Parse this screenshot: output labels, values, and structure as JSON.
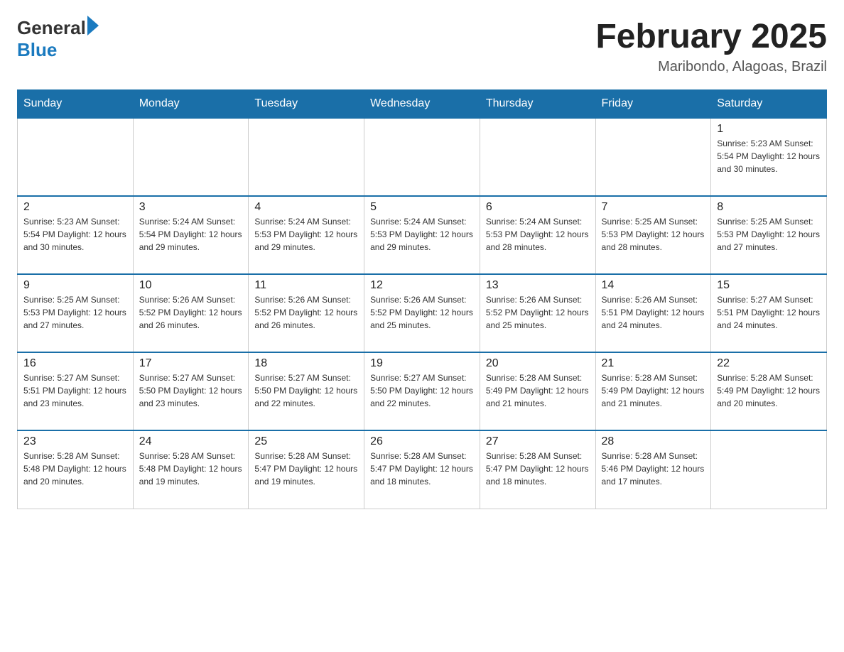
{
  "header": {
    "logo": {
      "general": "General",
      "blue": "Blue"
    },
    "title": "February 2025",
    "subtitle": "Maribondo, Alagoas, Brazil"
  },
  "days_of_week": [
    "Sunday",
    "Monday",
    "Tuesday",
    "Wednesday",
    "Thursday",
    "Friday",
    "Saturday"
  ],
  "weeks": [
    [
      {
        "day": "",
        "info": "",
        "empty": true
      },
      {
        "day": "",
        "info": "",
        "empty": true
      },
      {
        "day": "",
        "info": "",
        "empty": true
      },
      {
        "day": "",
        "info": "",
        "empty": true
      },
      {
        "day": "",
        "info": "",
        "empty": true
      },
      {
        "day": "",
        "info": "",
        "empty": true
      },
      {
        "day": "1",
        "info": "Sunrise: 5:23 AM\nSunset: 5:54 PM\nDaylight: 12 hours and 30 minutes.",
        "empty": false
      }
    ],
    [
      {
        "day": "2",
        "info": "Sunrise: 5:23 AM\nSunset: 5:54 PM\nDaylight: 12 hours and 30 minutes.",
        "empty": false
      },
      {
        "day": "3",
        "info": "Sunrise: 5:24 AM\nSunset: 5:54 PM\nDaylight: 12 hours and 29 minutes.",
        "empty": false
      },
      {
        "day": "4",
        "info": "Sunrise: 5:24 AM\nSunset: 5:53 PM\nDaylight: 12 hours and 29 minutes.",
        "empty": false
      },
      {
        "day": "5",
        "info": "Sunrise: 5:24 AM\nSunset: 5:53 PM\nDaylight: 12 hours and 29 minutes.",
        "empty": false
      },
      {
        "day": "6",
        "info": "Sunrise: 5:24 AM\nSunset: 5:53 PM\nDaylight: 12 hours and 28 minutes.",
        "empty": false
      },
      {
        "day": "7",
        "info": "Sunrise: 5:25 AM\nSunset: 5:53 PM\nDaylight: 12 hours and 28 minutes.",
        "empty": false
      },
      {
        "day": "8",
        "info": "Sunrise: 5:25 AM\nSunset: 5:53 PM\nDaylight: 12 hours and 27 minutes.",
        "empty": false
      }
    ],
    [
      {
        "day": "9",
        "info": "Sunrise: 5:25 AM\nSunset: 5:53 PM\nDaylight: 12 hours and 27 minutes.",
        "empty": false
      },
      {
        "day": "10",
        "info": "Sunrise: 5:26 AM\nSunset: 5:52 PM\nDaylight: 12 hours and 26 minutes.",
        "empty": false
      },
      {
        "day": "11",
        "info": "Sunrise: 5:26 AM\nSunset: 5:52 PM\nDaylight: 12 hours and 26 minutes.",
        "empty": false
      },
      {
        "day": "12",
        "info": "Sunrise: 5:26 AM\nSunset: 5:52 PM\nDaylight: 12 hours and 25 minutes.",
        "empty": false
      },
      {
        "day": "13",
        "info": "Sunrise: 5:26 AM\nSunset: 5:52 PM\nDaylight: 12 hours and 25 minutes.",
        "empty": false
      },
      {
        "day": "14",
        "info": "Sunrise: 5:26 AM\nSunset: 5:51 PM\nDaylight: 12 hours and 24 minutes.",
        "empty": false
      },
      {
        "day": "15",
        "info": "Sunrise: 5:27 AM\nSunset: 5:51 PM\nDaylight: 12 hours and 24 minutes.",
        "empty": false
      }
    ],
    [
      {
        "day": "16",
        "info": "Sunrise: 5:27 AM\nSunset: 5:51 PM\nDaylight: 12 hours and 23 minutes.",
        "empty": false
      },
      {
        "day": "17",
        "info": "Sunrise: 5:27 AM\nSunset: 5:50 PM\nDaylight: 12 hours and 23 minutes.",
        "empty": false
      },
      {
        "day": "18",
        "info": "Sunrise: 5:27 AM\nSunset: 5:50 PM\nDaylight: 12 hours and 22 minutes.",
        "empty": false
      },
      {
        "day": "19",
        "info": "Sunrise: 5:27 AM\nSunset: 5:50 PM\nDaylight: 12 hours and 22 minutes.",
        "empty": false
      },
      {
        "day": "20",
        "info": "Sunrise: 5:28 AM\nSunset: 5:49 PM\nDaylight: 12 hours and 21 minutes.",
        "empty": false
      },
      {
        "day": "21",
        "info": "Sunrise: 5:28 AM\nSunset: 5:49 PM\nDaylight: 12 hours and 21 minutes.",
        "empty": false
      },
      {
        "day": "22",
        "info": "Sunrise: 5:28 AM\nSunset: 5:49 PM\nDaylight: 12 hours and 20 minutes.",
        "empty": false
      }
    ],
    [
      {
        "day": "23",
        "info": "Sunrise: 5:28 AM\nSunset: 5:48 PM\nDaylight: 12 hours and 20 minutes.",
        "empty": false
      },
      {
        "day": "24",
        "info": "Sunrise: 5:28 AM\nSunset: 5:48 PM\nDaylight: 12 hours and 19 minutes.",
        "empty": false
      },
      {
        "day": "25",
        "info": "Sunrise: 5:28 AM\nSunset: 5:47 PM\nDaylight: 12 hours and 19 minutes.",
        "empty": false
      },
      {
        "day": "26",
        "info": "Sunrise: 5:28 AM\nSunset: 5:47 PM\nDaylight: 12 hours and 18 minutes.",
        "empty": false
      },
      {
        "day": "27",
        "info": "Sunrise: 5:28 AM\nSunset: 5:47 PM\nDaylight: 12 hours and 18 minutes.",
        "empty": false
      },
      {
        "day": "28",
        "info": "Sunrise: 5:28 AM\nSunset: 5:46 PM\nDaylight: 12 hours and 17 minutes.",
        "empty": false
      },
      {
        "day": "",
        "info": "",
        "empty": true
      }
    ]
  ]
}
